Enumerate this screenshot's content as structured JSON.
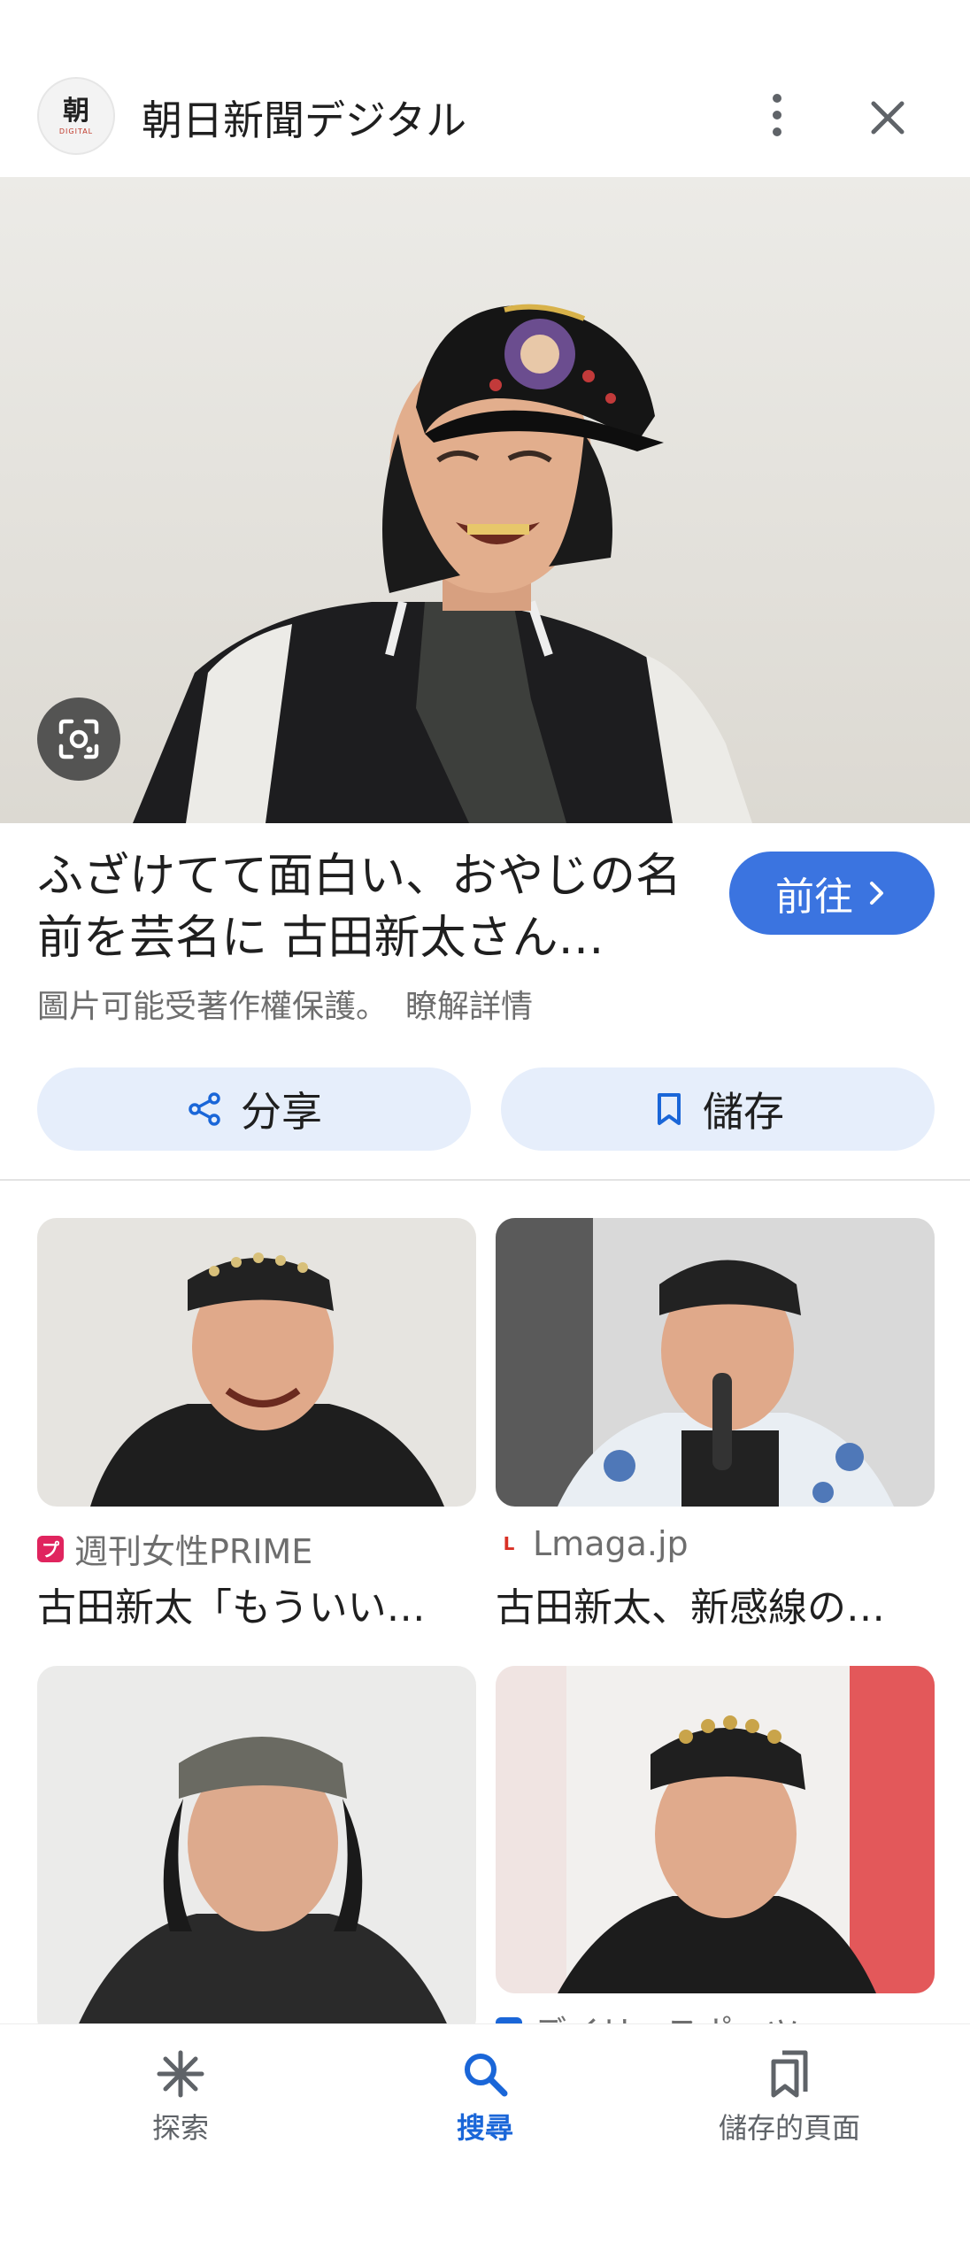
{
  "header": {
    "site_name": "朝日新聞デジタル",
    "logo_glyph": "朝",
    "logo_sub": "DIGITAL"
  },
  "hero": {
    "alt": "Laughing man in black cap and stadium jacket",
    "lens_icon": "google-lens-icon"
  },
  "result": {
    "title": "ふざけてて面白い、おやじの名前を芸名に 古田新太さん…",
    "visit_label": "前往",
    "copyright_notice": "圖片可能受著作權保護。",
    "learn_more": "瞭解詳情",
    "share_label": "分享",
    "save_label": "儲存"
  },
  "related": [
    {
      "source": "週刊女性PRIME",
      "caption": "古田新太「もういい…",
      "favicon_color": "#e0245e",
      "favicon_letter": "プ"
    },
    {
      "source": "Lmaga.jp",
      "caption": "古田新太、新感線の…",
      "favicon_color": "#d93025",
      "favicon_letter": "L"
    },
    {
      "source": "",
      "caption": "",
      "favicon_color": "#9aa0a6",
      "favicon_letter": ""
    },
    {
      "source": "デイリースポーツ",
      "caption": "",
      "favicon_color": "#1a66d8",
      "favicon_letter": ""
    }
  ],
  "bottom_nav": {
    "items": [
      {
        "label": "探索",
        "icon": "asterisk-icon"
      },
      {
        "label": "搜尋",
        "icon": "search-icon"
      },
      {
        "label": "儲存的頁面",
        "icon": "bookmarks-icon"
      }
    ],
    "active_index": 1
  },
  "colors": {
    "accent": "#3b74e0",
    "chip_bg": "#e6eefb",
    "active_nav": "#1a66d8"
  }
}
